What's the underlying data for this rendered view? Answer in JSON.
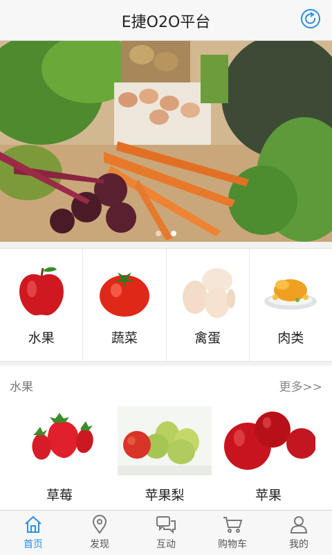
{
  "header": {
    "title": "E捷O2O平台",
    "refresh_icon": "refresh-icon"
  },
  "banner": {
    "image": "vegetables-eggs-carrots-beets-photo",
    "slides": 2,
    "active_slide": 2
  },
  "categories": [
    {
      "label": "水果",
      "icon": "apple-icon"
    },
    {
      "label": "蔬菜",
      "icon": "tomato-icon"
    },
    {
      "label": "禽蛋",
      "icon": "eggs-icon"
    },
    {
      "label": "肉类",
      "icon": "roast-chicken-icon"
    }
  ],
  "section": {
    "title": "水果",
    "more": "更多>>",
    "products": [
      {
        "name": "草莓",
        "image": "strawberries-photo"
      },
      {
        "name": "苹果梨",
        "image": "apple-pears-photo"
      },
      {
        "name": "苹果",
        "image": "red-apples-photo"
      }
    ]
  },
  "tabbar": {
    "items": [
      {
        "label": "首页",
        "icon": "home-icon",
        "active": true
      },
      {
        "label": "发现",
        "icon": "location-pin-icon"
      },
      {
        "label": "互动",
        "icon": "chat-bubbles-icon"
      },
      {
        "label": "购物车",
        "icon": "cart-icon"
      },
      {
        "label": "我的",
        "icon": "user-icon"
      }
    ]
  },
  "colors": {
    "accent": "#2a8ee0",
    "background": "#f2f2f2"
  }
}
